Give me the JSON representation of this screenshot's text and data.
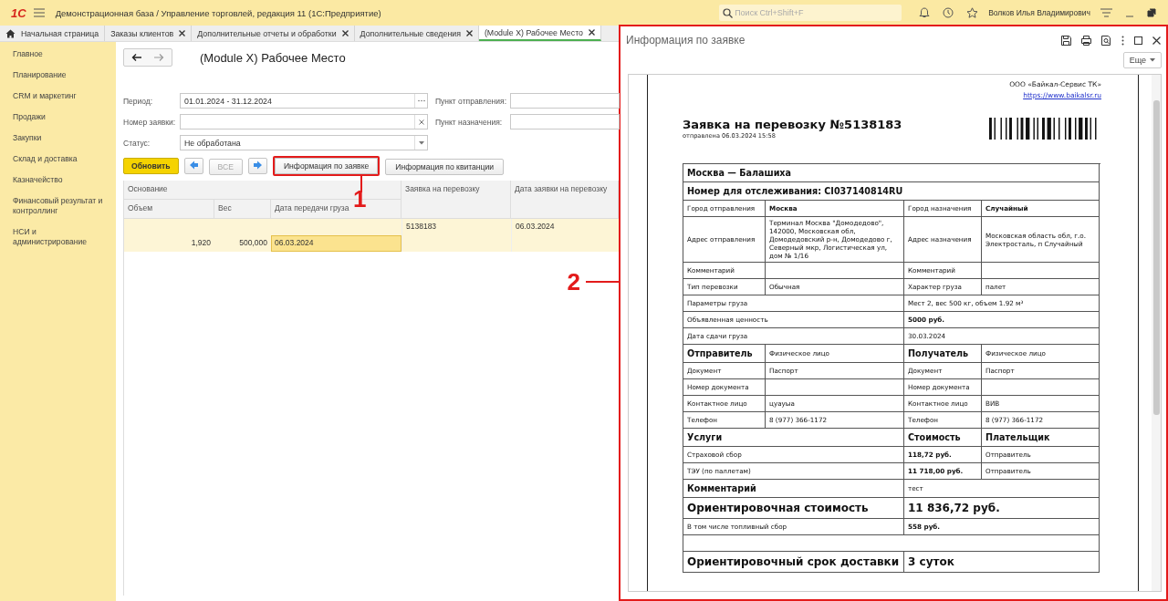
{
  "topbar": {
    "logo": "1С",
    "title": "Демонстрационная база / Управление торговлей, редакция 11  (1С:Предприятие)",
    "search_placeholder": "Поиск Ctrl+Shift+F",
    "user": "Волков Илья Владимирович"
  },
  "tabs": [
    {
      "label": "Начальная страница",
      "selected": false,
      "kind": "home"
    },
    {
      "label": "Заказы клиентов",
      "selected": false,
      "kind": "closable"
    },
    {
      "label": "Дополнительные отчеты и обработки",
      "selected": false,
      "kind": "closable"
    },
    {
      "label": "Дополнительные сведения",
      "selected": false,
      "kind": "closable"
    },
    {
      "label": "(Module X) Рабочее Место",
      "selected": true,
      "kind": "closable"
    }
  ],
  "sidebar": {
    "items": [
      "Главное",
      "Планирование",
      "CRM и маркетинг",
      "Продажи",
      "Закупки",
      "Склад и доставка",
      "Казначейство",
      "Финансовый результат и контроллинг",
      "НСИ и администрирование"
    ]
  },
  "form": {
    "title": "(Module X) Рабочее Место",
    "fields": [
      {
        "label": "Период:",
        "value": "01.01.2024 - 31.12.2024",
        "kind": "choose"
      },
      {
        "label": "Номер заявки:",
        "kind": "clear"
      },
      {
        "label": "Статус:",
        "value": "Не обработана",
        "kind": "select"
      }
    ],
    "side_fields": [
      {
        "label": "Пункт отправления:"
      },
      {
        "label": "Пункт назначения:"
      }
    ],
    "buttons": [
      {
        "kind": "primary",
        "label": "Обновить",
        "highlighted": false
      },
      {
        "kind": "prev",
        "highlighted": false
      },
      {
        "kind": "plain",
        "label": "ВСЕ",
        "disabled": true,
        "highlighted": false
      },
      {
        "kind": "next",
        "highlighted": false
      },
      {
        "kind": "plain",
        "label": "Информация по заявке",
        "disabled": false,
        "highlighted": true
      },
      {
        "kind": "plain",
        "label": "Информация по квитанции",
        "disabled": false,
        "highlighted": false
      }
    ],
    "table": {
      "group_heading": "Основание",
      "columns_top": [
        "Заявка на перевозку",
        "Дата заявки на перевозку"
      ],
      "columns_sub": [
        "Объем",
        "Вес",
        "Дата передачи груза"
      ],
      "rows": [
        {
          "order": "5138183",
          "order_date": "06.03.2024",
          "volume": "1,920",
          "weight": "500,000",
          "handover_date": "06.03.2024",
          "selected": true
        }
      ]
    }
  },
  "markers": [
    {
      "label": "1"
    },
    {
      "label": "2"
    }
  ],
  "panel": {
    "title": "Информация по заявке",
    "more_button": "Еще",
    "document": {
      "company": "ООО «Байкал-Сервис ТК»",
      "link": "https://www.baikalsr.ru",
      "heading": "Заявка на перевозку №5138183",
      "sent": "отправлена 06.03.2024 15:58",
      "rows": [
        {
          "kind": "full",
          "cells": [
            {
              "text": "Москва — Балашиха",
              "kind": "heading"
            }
          ]
        },
        {
          "kind": "full",
          "cells": [
            {
              "text": "Номер для отслеживания: CI037140814RU",
              "kind": "heading"
            }
          ]
        },
        {
          "kind": "quad",
          "cells": [
            {
              "text": "Город отправления",
              "kind": "plain"
            },
            {
              "text": "Москва",
              "kind": "bold"
            },
            {
              "text": "Город назначения",
              "kind": "plain"
            },
            {
              "text": "Случайный",
              "kind": "bold"
            }
          ]
        },
        {
          "kind": "quad",
          "cells": [
            {
              "text": "Адрес отправления",
              "kind": "plain"
            },
            {
              "text": "Терминал Москва \"Домодедово\", 142000, Московская обл, Домодедовский р-н, Домодедово г, Северный мкр, Логистическая ул, дом № 1/16",
              "kind": "plain"
            },
            {
              "text": "Адрес назначения",
              "kind": "plain"
            },
            {
              "text": "Московская область обл, г.о. Электросталь, п Случайный",
              "kind": "plain"
            }
          ]
        },
        {
          "kind": "quad",
          "cells": [
            {
              "text": "Комментарий",
              "kind": "plain"
            },
            {
              "kind": "empty"
            },
            {
              "text": "Комментарий",
              "kind": "plain"
            },
            {
              "kind": "empty"
            }
          ]
        },
        {
          "kind": "quad",
          "cells": [
            {
              "text": "Тип перевозки",
              "kind": "plain"
            },
            {
              "text": "Обычная",
              "kind": "plain"
            },
            {
              "text": "Характер груза",
              "kind": "plain"
            },
            {
              "text": "палет",
              "kind": "plain"
            }
          ]
        },
        {
          "kind": "half",
          "cells": [
            {
              "text": "Параметры груза",
              "kind": "plain"
            },
            {
              "text": "Мест 2, вес 500 кг, объем 1.92 м³",
              "kind": "plain"
            }
          ]
        },
        {
          "kind": "half",
          "cells": [
            {
              "text": "Объявленная ценность",
              "kind": "plain"
            },
            {
              "text": "5000 руб.",
              "kind": "bold"
            }
          ]
        },
        {
          "kind": "half",
          "cells": [
            {
              "text": "Дата сдачи груза",
              "kind": "plain"
            },
            {
              "text": "30.03.2024",
              "kind": "plain"
            }
          ]
        },
        {
          "kind": "quad",
          "cells": [
            {
              "text": "Отправитель",
              "kind": "heading"
            },
            {
              "text": "Физическое лицо",
              "kind": "plain"
            },
            {
              "text": "Получатель",
              "kind": "heading"
            },
            {
              "text": "Физическое лицо",
              "kind": "plain"
            }
          ]
        },
        {
          "kind": "quad",
          "cells": [
            {
              "text": "Документ",
              "kind": "plain"
            },
            {
              "text": "Паспорт",
              "kind": "plain"
            },
            {
              "text": "Документ",
              "kind": "plain"
            },
            {
              "text": "Паспорт",
              "kind": "plain"
            }
          ]
        },
        {
          "kind": "quad",
          "cells": [
            {
              "text": "Номер документа",
              "kind": "plain"
            },
            {
              "kind": "empty"
            },
            {
              "text": "Номер документа",
              "kind": "plain"
            },
            {
              "kind": "empty"
            }
          ]
        },
        {
          "kind": "quad",
          "cells": [
            {
              "text": "Контактное лицо",
              "kind": "plain"
            },
            {
              "text": "цуауыа",
              "kind": "plain"
            },
            {
              "text": "Контактное лицо",
              "kind": "plain"
            },
            {
              "text": "ВИВ",
              "kind": "plain"
            }
          ]
        },
        {
          "kind": "quad",
          "cells": [
            {
              "text": "Телефон",
              "kind": "plain"
            },
            {
              "text": "8 (977) 366-1172",
              "kind": "plain"
            },
            {
              "text": "Телефон",
              "kind": "plain"
            },
            {
              "text": "8 (977) 366-1172",
              "kind": "plain"
            }
          ]
        },
        {
          "kind": "tri",
          "cells": [
            {
              "text": "Услуги",
              "kind": "heading"
            },
            {
              "text": "Стоимость",
              "kind": "heading"
            },
            {
              "text": "Плательщик",
              "kind": "heading"
            }
          ]
        },
        {
          "kind": "tri",
          "cells": [
            {
              "text": "Страховой сбор",
              "kind": "plain"
            },
            {
              "text": "118,72 руб.",
              "kind": "bold"
            },
            {
              "text": "Отправитель",
              "kind": "plain"
            }
          ]
        },
        {
          "kind": "tri",
          "cells": [
            {
              "text": "ТЭУ (по паллетам)",
              "kind": "plain"
            },
            {
              "text": "11 718,00 руб.",
              "kind": "bold"
            },
            {
              "text": "Отправитель",
              "kind": "plain"
            }
          ]
        },
        {
          "kind": "half",
          "cells": [
            {
              "text": "Комментарий",
              "kind": "heading"
            },
            {
              "text": "тест",
              "kind": "plain"
            }
          ]
        },
        {
          "kind": "half",
          "cells": [
            {
              "text": "Ориентировочная стоимость",
              "kind": "big"
            },
            {
              "text": "11 836,72 руб.",
              "kind": "big"
            }
          ]
        },
        {
          "kind": "half",
          "cells": [
            {
              "text": "В том числе топливный сбор",
              "kind": "plain"
            },
            {
              "text": "558 руб.",
              "kind": "bold"
            }
          ]
        },
        {
          "kind": "spacer",
          "cells": []
        },
        {
          "kind": "half",
          "cells": [
            {
              "text": "Ориентировочный срок доставки",
              "kind": "big"
            },
            {
              "text": "3 суток",
              "kind": "big"
            }
          ]
        }
      ]
    }
  }
}
